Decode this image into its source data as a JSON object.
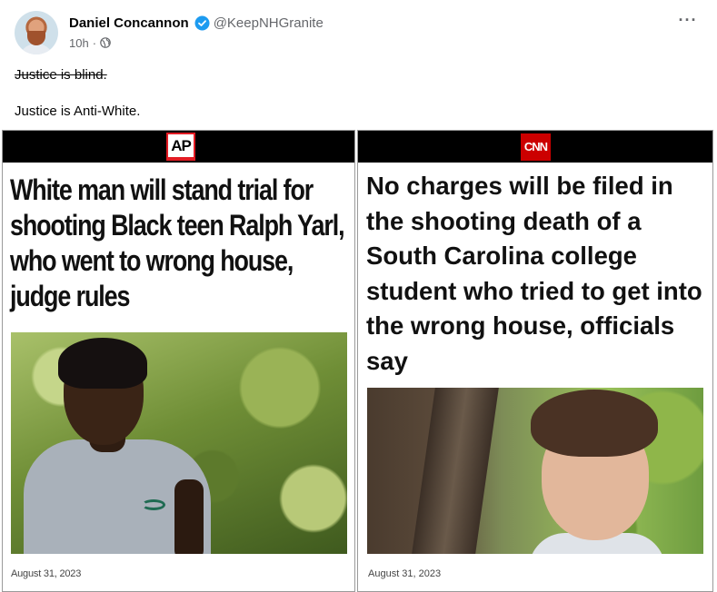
{
  "post": {
    "author_name": "Daniel Concannon",
    "handle": "@KeepNHGranite",
    "time": "10h",
    "dot": "·",
    "more": "···",
    "text_strikethrough": "Justice is blind.",
    "text_line2": "Justice is Anti-White."
  },
  "meme": {
    "left": {
      "logo": "AP",
      "headline": "White man will stand trial for shooting Black teen Ralph Yarl, who went to wrong house, judge rules",
      "date": "August 31, 2023"
    },
    "right": {
      "logo": "CNN",
      "headline": "No charges will be filed in the shooting death of a South Carolina college student who tried to get into the wrong house, officials say",
      "date": "August 31, 2023"
    }
  },
  "colors": {
    "verified": "#1d9bf0",
    "secondary_text": "#65676b",
    "cnn_red": "#cc0000",
    "ap_red": "#e31b23"
  },
  "icons": [
    "verified-icon",
    "globe-icon",
    "more-icon"
  ]
}
